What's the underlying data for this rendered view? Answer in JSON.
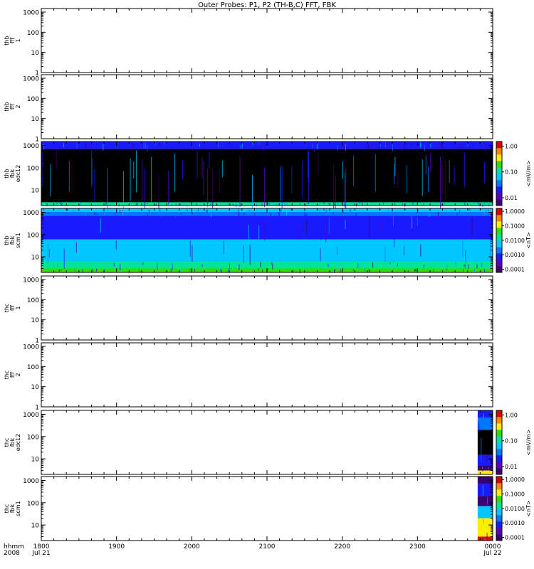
{
  "title": "Outer Probes: P1, P2 (TH-B,C) FFT, FBK",
  "colors": {
    "background": "#000000",
    "panel_frame": "#000000",
    "colormap": [
      "#3a0070",
      "#5a00c0",
      "#1a1aff",
      "#0077ff",
      "#00c8ff",
      "#00e39a",
      "#33dd00",
      "#ffee00",
      "#ff8800",
      "#dd0000"
    ]
  },
  "chart_data": [
    {
      "type": "heatmap",
      "panel": "thb-fff-1",
      "ylabel_lines": [
        "thb",
        "fff",
        "1"
      ],
      "yscale": "log",
      "ylim": [
        1,
        1500
      ],
      "ytick_labels": [
        "1",
        "10",
        "100",
        "1000"
      ],
      "ytick_values": [
        1,
        10,
        100,
        1000
      ],
      "data_coverage": "none"
    },
    {
      "type": "heatmap",
      "panel": "thb-fff-2",
      "ylabel_lines": [
        "thb",
        "fff",
        "2"
      ],
      "yscale": "log",
      "ylim": [
        1,
        1500
      ],
      "ytick_labels": [
        "1",
        "10",
        "100",
        "1000"
      ],
      "ytick_values": [
        1,
        10,
        100,
        1000
      ],
      "data_coverage": "none"
    },
    {
      "type": "heatmap",
      "panel": "thb-fbk-edc12",
      "ylabel_lines": [
        "thb",
        "fbk",
        "edc12"
      ],
      "yscale": "log",
      "ylim": [
        2,
        1500
      ],
      "ytick_labels": [
        "10",
        "100",
        "1000"
      ],
      "ytick_values": [
        10,
        100,
        1000
      ],
      "data_coverage": "full",
      "bands": [
        {
          "f_low": 700,
          "f_high": 1500,
          "color": "#1a1aff"
        },
        {
          "f_low": 2.8,
          "f_high": 700,
          "color": "#000000"
        },
        {
          "f_low": 2,
          "f_high": 2.8,
          "color": "#00e39a"
        }
      ],
      "colorbar": {
        "label": "<mV/m>",
        "scale": "log",
        "range": [
          0.005,
          1.5
        ],
        "tick_labels": [
          "1.00",
          "0.10",
          "0.01"
        ],
        "tick_values": [
          1.0,
          0.1,
          0.01
        ]
      }
    },
    {
      "type": "heatmap",
      "panel": "thb-fbk-scm1",
      "ylabel_lines": [
        "thb",
        "fbk",
        "scm1"
      ],
      "yscale": "log",
      "ylim": [
        2,
        1500
      ],
      "ytick_labels": [
        "10",
        "100",
        "1000"
      ],
      "ytick_values": [
        10,
        100,
        1000
      ],
      "data_coverage": "full",
      "bands": [
        {
          "f_low": 1050,
          "f_high": 1500,
          "color": "#00c8ff"
        },
        {
          "f_low": 700,
          "f_high": 1050,
          "color": "#0077ff"
        },
        {
          "f_low": 60,
          "f_high": 700,
          "color": "#1a1aff"
        },
        {
          "f_low": 6,
          "f_high": 60,
          "color": "#00c8ff"
        },
        {
          "f_low": 3,
          "f_high": 6,
          "color": "#00e39a"
        },
        {
          "f_low": 2,
          "f_high": 3,
          "color": "#33dd00"
        }
      ],
      "colorbar": {
        "label": "<nT>",
        "scale": "log",
        "range": [
          6e-05,
          1.6
        ],
        "tick_labels": [
          "1.0000",
          "0.1000",
          "0.0100",
          "0.0010",
          "0.0001"
        ],
        "tick_values": [
          1.0,
          0.1,
          0.01,
          0.001,
          0.0001
        ]
      }
    },
    {
      "type": "heatmap",
      "panel": "thc-fff-1",
      "ylabel_lines": [
        "thc",
        "fff",
        "1"
      ],
      "yscale": "log",
      "ylim": [
        1,
        1500
      ],
      "ytick_labels": [
        "1",
        "10",
        "100",
        "1000"
      ],
      "ytick_values": [
        1,
        10,
        100,
        1000
      ],
      "data_coverage": "none"
    },
    {
      "type": "heatmap",
      "panel": "thc-fff-2",
      "ylabel_lines": [
        "thc",
        "fff",
        "2"
      ],
      "yscale": "log",
      "ylim": [
        1,
        1500
      ],
      "ytick_labels": [
        "1",
        "10",
        "100",
        "1000"
      ],
      "ytick_values": [
        1,
        10,
        100,
        1000
      ],
      "data_coverage": "none"
    },
    {
      "type": "heatmap",
      "panel": "thc-fbk-edc12",
      "ylabel_lines": [
        "thc",
        "fbk",
        "edc12"
      ],
      "yscale": "log",
      "ylim": [
        2,
        1500
      ],
      "ytick_labels": [
        "10",
        "100",
        "1000"
      ],
      "ytick_values": [
        10,
        100,
        1000
      ],
      "data_coverage": {
        "start": "2348",
        "end": "0000"
      },
      "bands": [
        {
          "f_low": 700,
          "f_high": 1500,
          "color": "#1a1aff"
        },
        {
          "f_low": 200,
          "f_high": 700,
          "color": "#0077ff"
        },
        {
          "f_low": 15,
          "f_high": 200,
          "color": "#000000"
        },
        {
          "f_low": 5,
          "f_high": 15,
          "color": "#1a1aff"
        },
        {
          "f_low": 3,
          "f_high": 5,
          "color": "#3a0070"
        },
        {
          "f_low": 2,
          "f_high": 3,
          "color": "#ffee00"
        }
      ],
      "colorbar": {
        "label": "<mV/m>",
        "scale": "log",
        "range": [
          0.005,
          1.5
        ],
        "tick_labels": [
          "1.00",
          "0.10",
          "0.01"
        ],
        "tick_values": [
          1.0,
          0.1,
          0.01
        ]
      }
    },
    {
      "type": "heatmap",
      "panel": "thc-fbk-scm1",
      "ylabel_lines": [
        "thc",
        "fbk",
        "scm1"
      ],
      "yscale": "log",
      "ylim": [
        2,
        1500
      ],
      "ytick_labels": [
        "10",
        "100",
        "1000"
      ],
      "ytick_values": [
        10,
        100,
        1000
      ],
      "data_coverage": {
        "start": "2348",
        "end": "0000"
      },
      "bands": [
        {
          "f_low": 700,
          "f_high": 1500,
          "color": "#3a0070"
        },
        {
          "f_low": 200,
          "f_high": 700,
          "color": "#1a1aff"
        },
        {
          "f_low": 70,
          "f_high": 200,
          "color": "#3a0070"
        },
        {
          "f_low": 20,
          "f_high": 70,
          "color": "#00c8ff"
        },
        {
          "f_low": 6,
          "f_high": 20,
          "color": "#ffee00"
        },
        {
          "f_low": 3,
          "f_high": 6,
          "color": "#ffee00"
        },
        {
          "f_low": 2,
          "f_high": 3,
          "color": "#dd0000"
        }
      ],
      "colorbar": {
        "label": "<nT>",
        "scale": "log",
        "range": [
          6e-05,
          1.6
        ],
        "tick_labels": [
          "1.0000",
          "0.1000",
          "0.0100",
          "0.0010",
          "0.0001"
        ],
        "tick_values": [
          1.0,
          0.1,
          0.01,
          0.001,
          0.0001
        ]
      }
    }
  ],
  "x_axis": {
    "range": [
      "1800",
      "0000"
    ],
    "tick_labels": [
      "1800",
      "1900",
      "2000",
      "2100",
      "2200",
      "2300",
      "0000"
    ],
    "date_labels": [
      "Jul 21",
      "",
      "",
      "",
      "",
      "",
      "Jul 22"
    ],
    "row_label_top": "hhmm",
    "row_label_bottom": "2008",
    "minor_ticks_per_major": 6
  }
}
